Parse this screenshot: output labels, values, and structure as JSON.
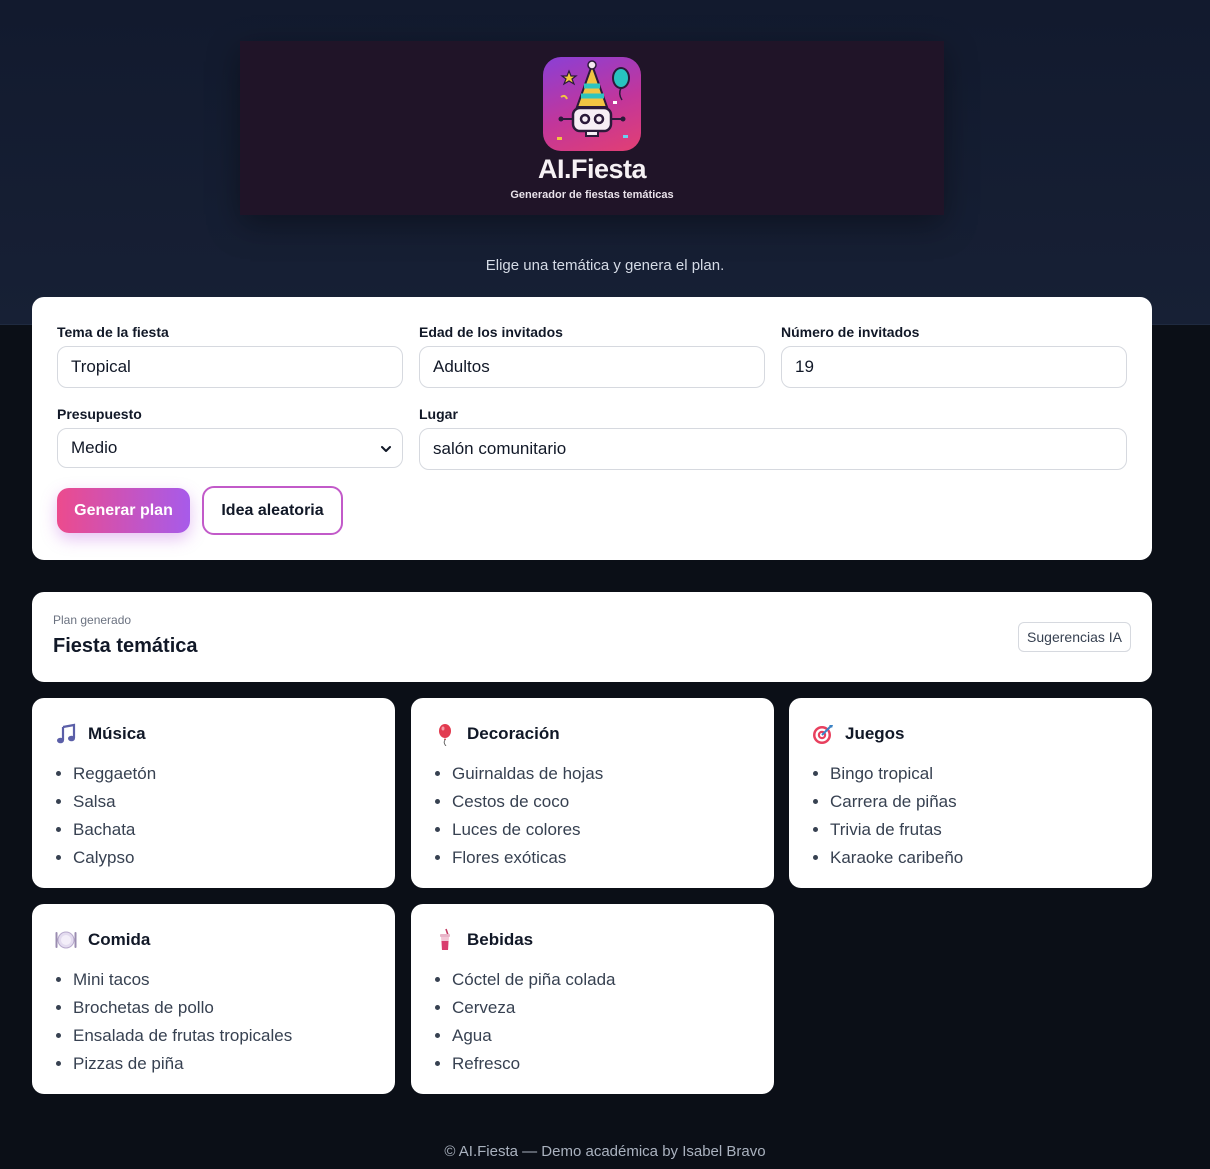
{
  "brand": {
    "title": "AI.Fiesta",
    "subtitle": "Generador de fiestas temáticas",
    "icon": "party-robot-icon"
  },
  "tagline": "Elige una temática y genera el plan.",
  "form": {
    "tema": {
      "label": "Tema de la fiesta",
      "value": "Tropical"
    },
    "edad": {
      "label": "Edad de los invitados",
      "value": "Adultos"
    },
    "numero": {
      "label": "Número de invitados",
      "value": "19"
    },
    "presupuesto": {
      "label": "Presupuesto",
      "value": "Medio",
      "icon": "chevron-down-icon"
    },
    "lugar": {
      "label": "Lugar",
      "value": "salón comunitario"
    },
    "generate_label": "Generar plan",
    "random_label": "Idea aleatoria"
  },
  "plan": {
    "kicker": "Plan generado",
    "title": "Fiesta temática",
    "badge": "Sugerencias IA"
  },
  "categories": [
    {
      "title": "Música",
      "icon": "music-note-icon",
      "items": [
        "Reggaetón",
        "Salsa",
        "Bachata",
        "Calypso"
      ]
    },
    {
      "title": "Decoración",
      "icon": "balloon-icon",
      "items": [
        "Guirnaldas de hojas",
        "Cestos de coco",
        "Luces de colores",
        "Flores exóticas"
      ]
    },
    {
      "title": "Juegos",
      "icon": "target-icon",
      "items": [
        "Bingo tropical",
        "Carrera de piñas",
        "Trivia de frutas",
        "Karaoke caribeño"
      ]
    },
    {
      "title": "Comida",
      "icon": "plate-icon",
      "items": [
        "Mini tacos",
        "Brochetas de pollo",
        "Ensalada de frutas tropicales",
        "Pizzas de piña"
      ]
    },
    {
      "title": "Bebidas",
      "icon": "drink-cup-icon",
      "items": [
        "Cóctel de piña colada",
        "Cerveza",
        "Agua",
        "Refresco"
      ]
    }
  ],
  "footer": "© AI.Fiesta — Demo académica by Isabel Bravo",
  "colors": {
    "accent_start": "#ec4b8d",
    "accent_end": "#a75bea",
    "page_bg": "#0b0f17",
    "hero_bg": "#121a2e"
  }
}
